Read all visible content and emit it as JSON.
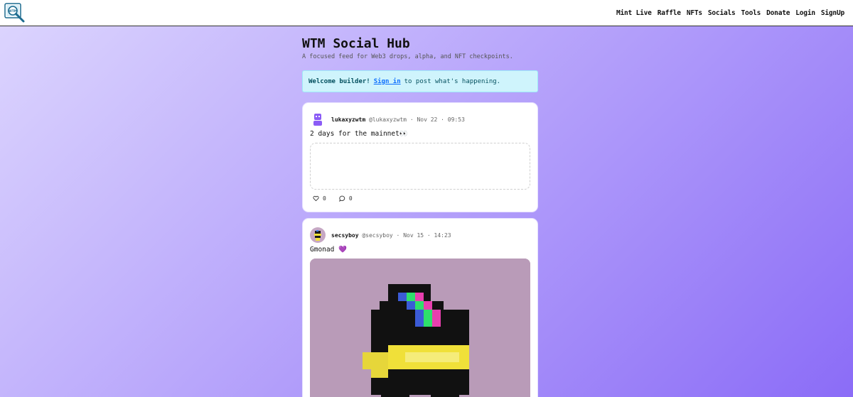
{
  "nav": {
    "logo_text": "WTM",
    "links": [
      "Mint Live",
      "Raffle",
      "NFTs",
      "Socials",
      "Tools",
      "Donate",
      "Login",
      "SignUp"
    ]
  },
  "header": {
    "title": "WTM Social Hub",
    "subtitle": "A focused feed for Web3 drops, alpha, and NFT checkpoints."
  },
  "welcome": {
    "lead": "Welcome builder!",
    "link": "Sign in",
    "tail": "to post what's happening."
  },
  "posts": [
    {
      "display_name": "lukaxyzwtm",
      "handle": "@lukaxyzwtm",
      "timestamp": "Nov 22 · 09:53",
      "text": "2 days for the mainnet👀",
      "likes": "0",
      "comments": "0",
      "avatar_icon": "purple-robot-avatar"
    },
    {
      "display_name": "secsyboy",
      "handle": "@secsyboy",
      "timestamp": "Nov 15 · 14:23",
      "text": "Gmonad 💜",
      "avatar_icon": "pixel-character-avatar",
      "image_icon": "pixel-art-nft-image"
    }
  ],
  "colors": {
    "accent_link": "#0d6efd",
    "welcome_bg": "#cff4fc",
    "gradient_start": "#ddd6fe",
    "gradient_end": "#8b6cf7",
    "nft_bg": "#b99bb8"
  }
}
